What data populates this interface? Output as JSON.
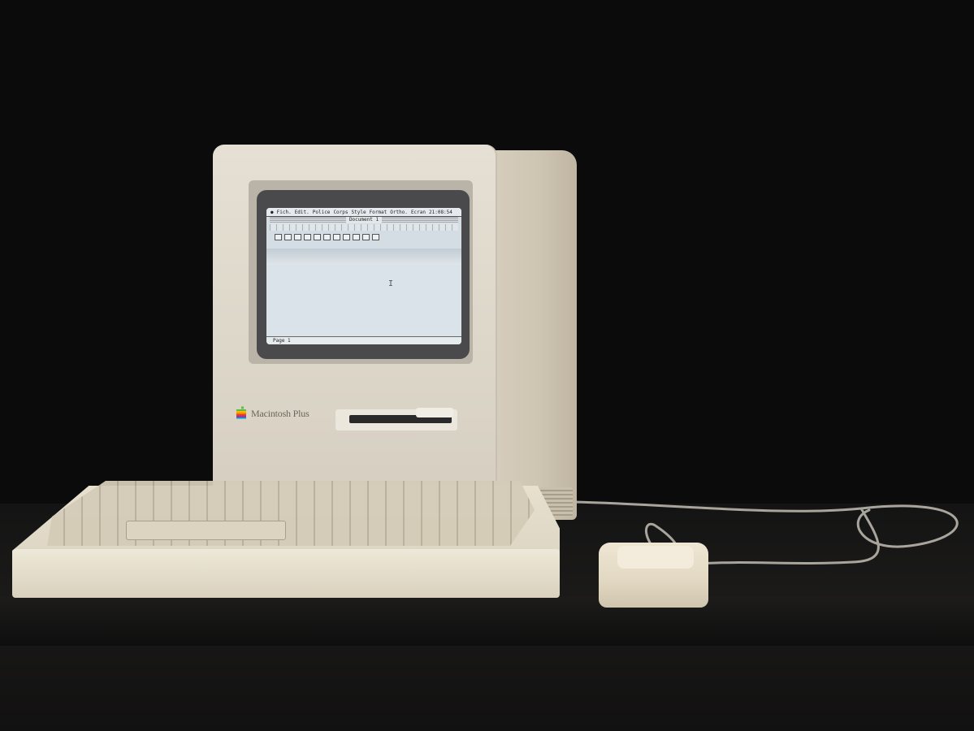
{
  "screen": {
    "menu": [
      "Fich.",
      "Edit.",
      "Police",
      "Corps",
      "Style",
      "Format",
      "Ortho.",
      "Ecran"
    ],
    "clock": "21:08:54",
    "window_title": "Document 1",
    "page_indicator": "Page 1"
  },
  "case": {
    "model_label": "Macintosh Plus"
  },
  "colors": {
    "case": "#e2dccf",
    "screen": "#d4dde3",
    "background": "#0b0b0c"
  }
}
